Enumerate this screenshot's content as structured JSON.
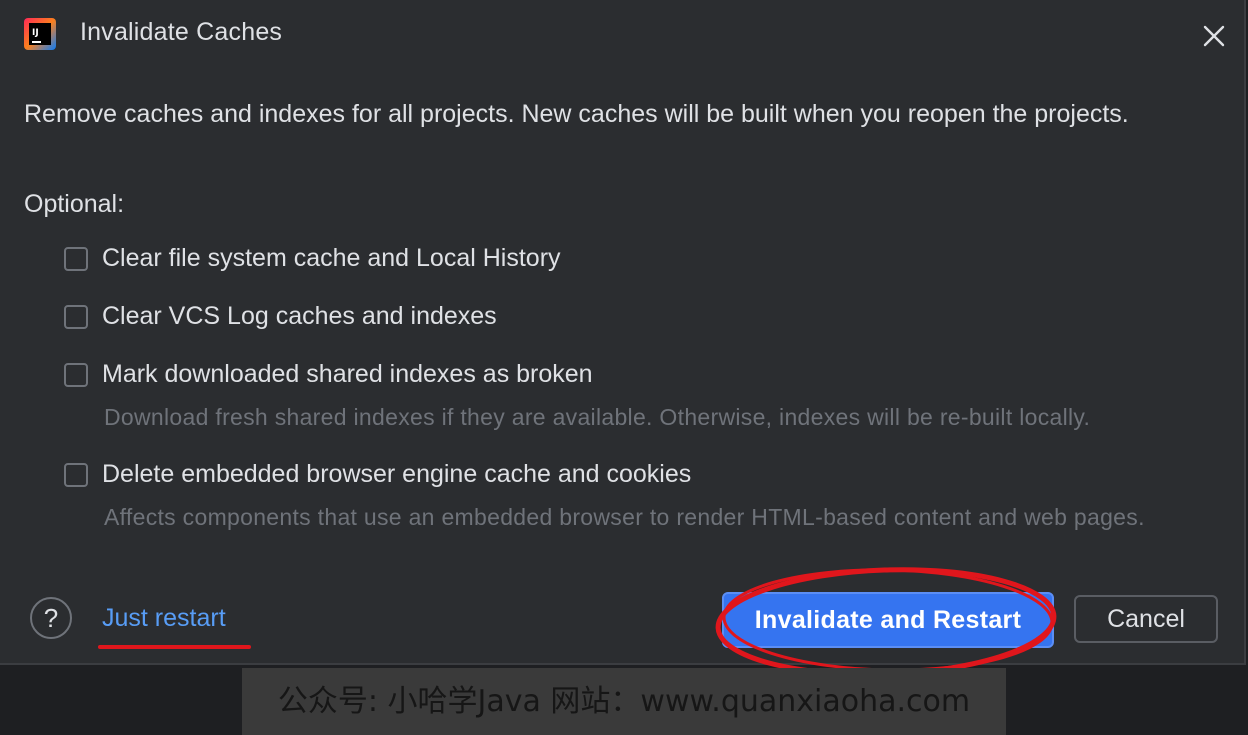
{
  "dialog": {
    "title": "Invalidate Caches",
    "app_icon": "intellij-idea-icon",
    "close_icon": "close-icon",
    "description": "Remove caches and indexes for all projects. New caches will be built when you reopen the projects.",
    "optional_label": "Optional:",
    "options": [
      {
        "label": "Clear file system cache and Local History",
        "checked": false,
        "hint": ""
      },
      {
        "label": "Clear VCS Log caches and indexes",
        "checked": false,
        "hint": ""
      },
      {
        "label": "Mark downloaded shared indexes as broken",
        "checked": false,
        "hint": "Download fresh shared indexes if they are available. Otherwise, indexes will be re-built locally."
      },
      {
        "label": "Delete embedded browser engine cache and cookies",
        "checked": false,
        "hint": "Affects components that use an embedded browser to render HTML-based content and web pages."
      }
    ],
    "footer": {
      "help_label": "?",
      "just_restart_label": "Just restart",
      "primary_label": "Invalidate and Restart",
      "cancel_label": "Cancel"
    }
  },
  "watermark": {
    "text": "公众号: 小哈学Java  网站：www.quanxiaoha.com"
  },
  "colors": {
    "dialog_bg": "#2b2d30",
    "text": "#dfe1e5",
    "hint_text": "#6f737a",
    "link": "#589df6",
    "primary_button": "#3574f0",
    "annotation_red": "#e0161c"
  }
}
